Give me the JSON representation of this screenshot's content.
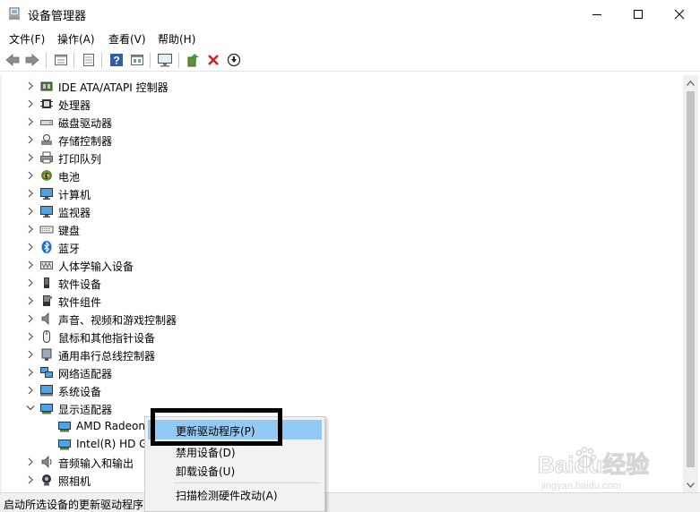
{
  "window": {
    "title": "设备管理器",
    "minimize_icon": "minimize-icon",
    "maximize_icon": "maximize-icon",
    "close_icon": "close-icon"
  },
  "menu": [
    {
      "label": "文件(F)"
    },
    {
      "label": "操作(A)"
    },
    {
      "label": "查看(V)"
    },
    {
      "label": "帮助(H)"
    }
  ],
  "toolbar": [
    "back-icon",
    "forward-icon",
    "properties-icon",
    "view-icon",
    "help-icon",
    "view-details-icon",
    "monitor-scan-icon",
    "update-driver-icon",
    "uninstall-icon",
    "download-icon"
  ],
  "tree": [
    {
      "label": "IDE ATA/ATAPI 控制器",
      "icon": "ide-controller-icon",
      "expanded": false
    },
    {
      "label": "处理器",
      "icon": "processor-icon",
      "expanded": false
    },
    {
      "label": "磁盘驱动器",
      "icon": "disk-drive-icon",
      "expanded": false
    },
    {
      "label": "存储控制器",
      "icon": "storage-controller-icon",
      "expanded": false
    },
    {
      "label": "打印队列",
      "icon": "printer-icon",
      "expanded": false
    },
    {
      "label": "电池",
      "icon": "battery-icon",
      "expanded": false
    },
    {
      "label": "计算机",
      "icon": "computer-icon",
      "expanded": false
    },
    {
      "label": "监视器",
      "icon": "monitor-icon",
      "expanded": false
    },
    {
      "label": "键盘",
      "icon": "keyboard-icon",
      "expanded": false
    },
    {
      "label": "蓝牙",
      "icon": "bluetooth-icon",
      "expanded": false
    },
    {
      "label": "人体学输入设备",
      "icon": "hid-icon",
      "expanded": false
    },
    {
      "label": "软件设备",
      "icon": "software-device-icon",
      "expanded": false
    },
    {
      "label": "软件组件",
      "icon": "software-component-icon",
      "expanded": false
    },
    {
      "label": "声音、视频和游戏控制器",
      "icon": "sound-icon",
      "expanded": false
    },
    {
      "label": "鼠标和其他指针设备",
      "icon": "mouse-icon",
      "expanded": false
    },
    {
      "label": "通用串行总线控制器",
      "icon": "usb-icon",
      "expanded": false
    },
    {
      "label": "网络适配器",
      "icon": "network-adapter-icon",
      "expanded": false
    },
    {
      "label": "系统设备",
      "icon": "system-device-icon",
      "expanded": false
    },
    {
      "label": "显示适配器",
      "icon": "display-adapter-icon",
      "expanded": true
    },
    {
      "label": "AMD Radeon",
      "icon": "display-device-icon",
      "child": true
    },
    {
      "label": "Intel(R) HD G",
      "icon": "display-device-icon",
      "child": true
    },
    {
      "label": "音频输入和输出",
      "icon": "audio-io-icon",
      "expanded": false
    },
    {
      "label": "照相机",
      "icon": "camera-icon",
      "expanded": false
    }
  ],
  "context_menu": {
    "items": [
      {
        "label": "更新驱动程序(P)",
        "highlighted": true
      },
      {
        "label": "禁用设备(D)"
      },
      {
        "label": "卸载设备(U)"
      },
      {
        "label": "扫描检测硬件改动(A)"
      }
    ]
  },
  "status": {
    "text": "启动所选设备的更新驱动程序向导。"
  },
  "watermark": {
    "brand_text": "Baidu经验",
    "url_text": "jingyan.baidu.com"
  },
  "colors": {
    "highlight": "#91c9f7",
    "callout_box": "#000000"
  }
}
